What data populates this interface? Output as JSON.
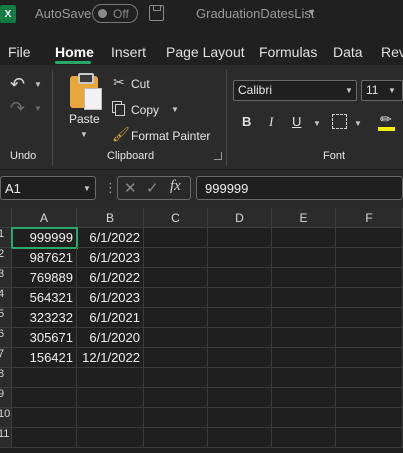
{
  "titlebar": {
    "app_icon_letter": "X",
    "autosave_label": "AutoSave",
    "autosave_state": "Off",
    "document_title": "GraduationDatesList"
  },
  "menu": {
    "tabs": [
      "File",
      "Home",
      "Insert",
      "Page Layout",
      "Formulas",
      "Data",
      "Rev"
    ],
    "active_tab": "Home"
  },
  "ribbon": {
    "undo_group_label": "Undo",
    "clipboard": {
      "paste_label": "Paste",
      "cut_label": "Cut",
      "copy_label": "Copy",
      "format_painter_label": "Format Painter",
      "group_label": "Clipboard"
    },
    "font": {
      "font_name": "Calibri",
      "font_size": "11",
      "bold": "B",
      "italic": "I",
      "underline": "U",
      "group_label": "Font",
      "fill_color": "#f5f000"
    }
  },
  "formula_bar": {
    "name_box": "A1",
    "fx_label": "fx",
    "value": "999999"
  },
  "grid": {
    "columns": [
      "A",
      "B",
      "C",
      "D",
      "E",
      "F"
    ],
    "rows": [
      "1",
      "2",
      "3",
      "4",
      "5",
      "6",
      "7",
      "8",
      "9",
      "10",
      "11"
    ],
    "cells": [
      [
        "999999",
        "6/1/2022"
      ],
      [
        "987621",
        "6/1/2023"
      ],
      [
        "769889",
        "6/1/2022"
      ],
      [
        "564321",
        "6/1/2023"
      ],
      [
        "323232",
        "6/1/2021"
      ],
      [
        "305671",
        "6/1/2020"
      ],
      [
        "156421",
        "12/1/2022"
      ]
    ],
    "selected_cell": "A1"
  },
  "colors": {
    "accent": "#2aa86b",
    "excel_green": "#107c41"
  }
}
